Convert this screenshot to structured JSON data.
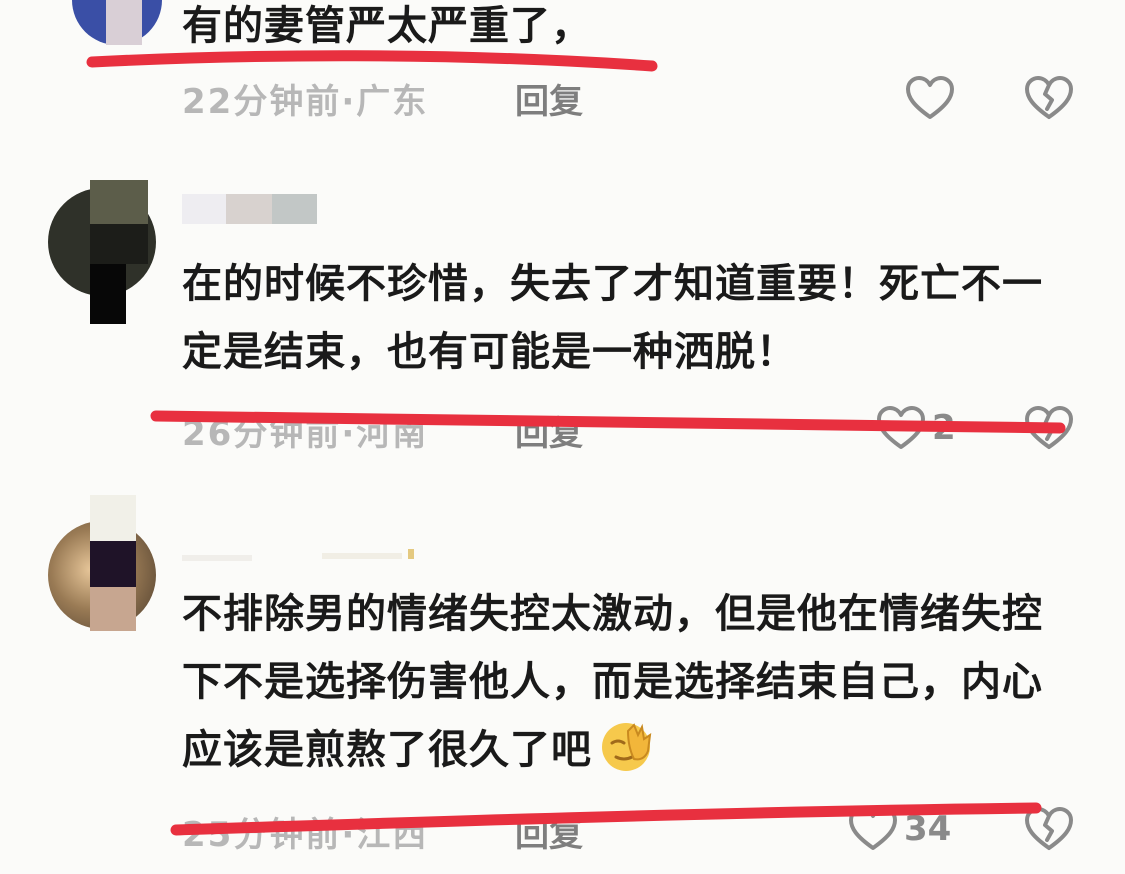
{
  "comments": [
    {
      "text": "有的妻管严太严重了，",
      "time": "22分钟前",
      "sep": "·",
      "location": "广东",
      "reply": "回复",
      "likes": ""
    },
    {
      "text": "在的时候不珍惜，失去了才知道重要！死亡不一定是结束，也有可能是一种洒脱！",
      "time": "26分钟前",
      "sep": "·",
      "location": "河南",
      "reply": "回复",
      "likes": "2"
    },
    {
      "text": "不排除男的情绪失控太激动，但是他在情绪失控下不是选择伤害他人，而是选择结束自己，内心应该是煎熬了很久了吧",
      "time": "25分钟前",
      "sep": "·",
      "location": "江西",
      "reply": "回复",
      "likes": "34"
    }
  ],
  "icons": {
    "like": "heart-outline-icon",
    "dislike": "broken-heart-icon",
    "emoji": "facepalm-emoji-icon"
  },
  "colors": {
    "annotation": "#e8303f",
    "meta": "#b7b7b7",
    "icon": "#8a8a8a"
  }
}
